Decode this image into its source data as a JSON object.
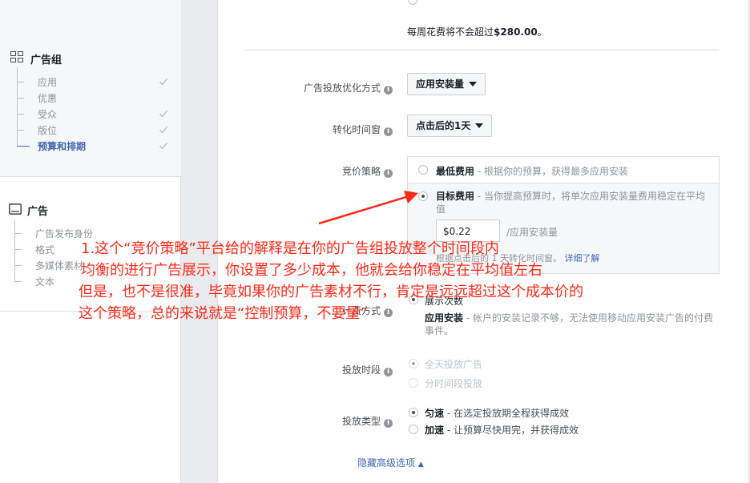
{
  "sidebar": {
    "adset": {
      "title": "广告组",
      "items": [
        {
          "label": "应用",
          "checked": true
        },
        {
          "label": "优惠",
          "checked": false
        },
        {
          "label": "受众",
          "checked": true
        },
        {
          "label": "版位",
          "checked": true
        },
        {
          "label": "预算和排期",
          "checked": true,
          "active": true
        }
      ]
    },
    "ad": {
      "title": "广告",
      "items": [
        {
          "label": "广告发布身份"
        },
        {
          "label": "格式"
        },
        {
          "label": "多媒体素材"
        },
        {
          "label": "文本"
        }
      ]
    }
  },
  "main": {
    "top_partial": "每周花费将不会超过",
    "spend_cap": "$280.00",
    "spend_cap_suffix": "。",
    "optimization": {
      "label": "广告投放优化方式",
      "value": "应用安装量"
    },
    "window": {
      "label": "转化时间窗",
      "value": "点击后的1天"
    },
    "bid": {
      "label": "竞价策略",
      "lowest": {
        "title": "最低费用",
        "desc": " - 根据你的预算，获得最多应用安装"
      },
      "target": {
        "title": "目标费用",
        "desc": " - 当你提高预算时，将单次应用安装量费用稳定在平均值",
        "value": "$0.22",
        "unit": "/应用安装量",
        "note": "根据点击后的 1 天转化时间窗。",
        "link": "详细了解"
      }
    },
    "charge": {
      "label": "计费方式",
      "opt1": "展示次数",
      "opt2_title": "应用安装",
      "opt2_desc": " - 帐户的安装记录不够，无法使用移动应用安装广告的付费事件。"
    },
    "schedule": {
      "label": "投放时段",
      "opt1": "全天投放广告",
      "opt2": "分时间段投放"
    },
    "delivery": {
      "label": "投放类型",
      "opt1_title": "匀速",
      "opt1_desc": " - 在选定投放期全程获得成效",
      "opt2_title": "加速",
      "opt2_desc": " - 让预算尽快用完，并获得成效"
    },
    "advanced_link": "隐藏高级选项"
  },
  "annotation": {
    "line1": "1.这个“竞价策略”平台给的解释是在你的广告组投放整个时间段内",
    "line2": "均衡的进行广告展示，你设置了多少成本，他就会给你稳定在平均值左右",
    "line3": "但是，也不是很准，毕竟如果你的广告素材不行，肯定是远远超过这个成本价的",
    "line4": "这个策略，总的来说就是“控制预算，不要量”",
    "color": "#ff2a1a"
  }
}
